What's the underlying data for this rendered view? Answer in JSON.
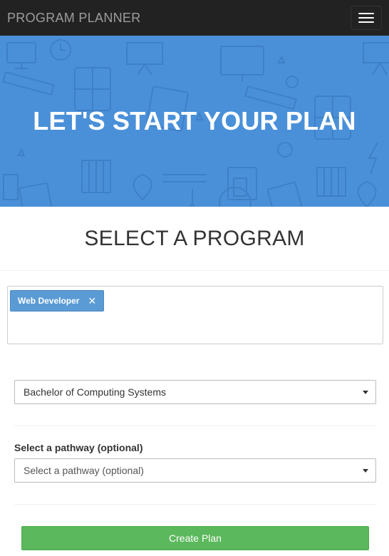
{
  "navbar": {
    "brand": "PROGRAM PLANNER",
    "menu_icon": "hamburger-menu-icon"
  },
  "hero": {
    "title": "LET'S START YOUR PLAN",
    "background_color": "#4a90d9"
  },
  "section": {
    "title": "SELECT A PROGRAM"
  },
  "tags": {
    "items": [
      {
        "label": "Web Developer",
        "remove_icon": "close-icon"
      }
    ],
    "tag_color": "#5b9bd5"
  },
  "program_select": {
    "value": "Bachelor of Computing Systems",
    "icon": "caret-down-icon"
  },
  "pathway": {
    "label": "Select a pathway (optional)",
    "placeholder": "Select a pathway (optional)",
    "icon": "caret-down-icon"
  },
  "actions": {
    "create_label": "Create Plan",
    "create_color": "#5cb85c"
  }
}
